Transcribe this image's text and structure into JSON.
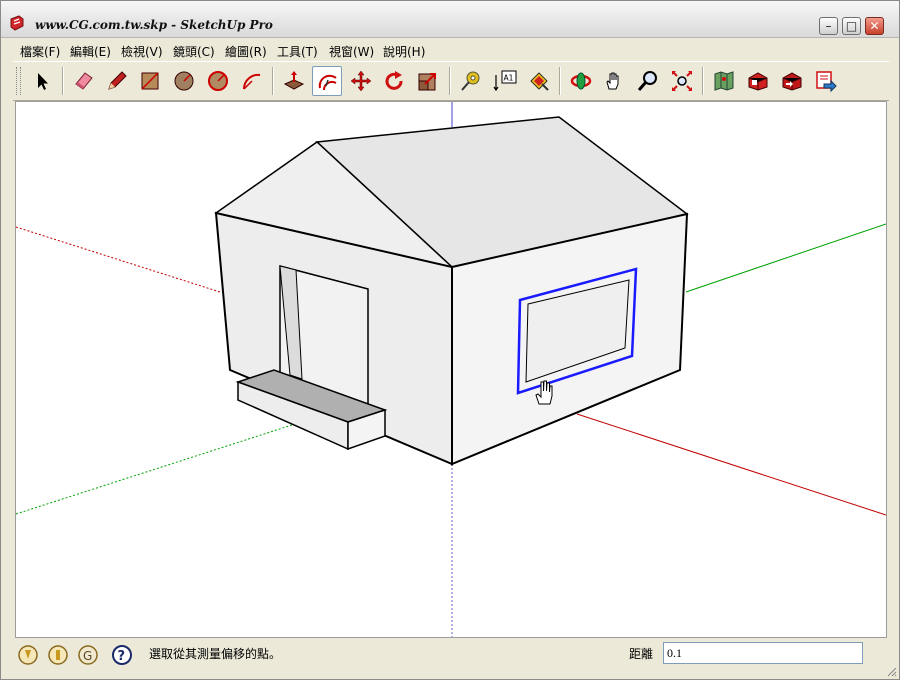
{
  "window": {
    "title": "www.CG.com.tw.skp - SketchUp Pro"
  },
  "menu": [
    {
      "id": "file",
      "label": "檔案(F)"
    },
    {
      "id": "edit",
      "label": "編輯(E)"
    },
    {
      "id": "view",
      "label": "檢視(V)"
    },
    {
      "id": "camera",
      "label": "鏡頭(C)"
    },
    {
      "id": "draw",
      "label": "繪圖(R)"
    },
    {
      "id": "tools",
      "label": "工具(T)"
    },
    {
      "id": "window",
      "label": "視窗(W)"
    },
    {
      "id": "help",
      "label": "說明(H)"
    }
  ],
  "toolbar": {
    "tools": [
      {
        "id": "select",
        "icon": "arrow-cursor-icon"
      },
      {
        "id": "eraser",
        "icon": "eraser-icon"
      },
      {
        "id": "line",
        "icon": "pencil-icon"
      },
      {
        "id": "rectangle",
        "icon": "rectangle-icon"
      },
      {
        "id": "circle",
        "icon": "circle-icon"
      },
      {
        "id": "polygon",
        "icon": "polygon-icon"
      },
      {
        "id": "arc",
        "icon": "arc-icon"
      },
      {
        "id": "push-pull",
        "icon": "push-pull-icon"
      },
      {
        "id": "offset",
        "icon": "offset-icon",
        "active": true
      },
      {
        "id": "move",
        "icon": "move-icon"
      },
      {
        "id": "rotate",
        "icon": "rotate-icon"
      },
      {
        "id": "scale",
        "icon": "scale-icon"
      },
      {
        "id": "tape-measure",
        "icon": "tape-measure-icon"
      },
      {
        "id": "text",
        "icon": "text-label-icon",
        "label": "A1"
      },
      {
        "id": "paint-bucket",
        "icon": "paint-bucket-icon"
      },
      {
        "id": "orbit",
        "icon": "orbit-icon"
      },
      {
        "id": "pan",
        "icon": "pan-hand-icon"
      },
      {
        "id": "zoom",
        "icon": "zoom-icon"
      },
      {
        "id": "zoom-extents",
        "icon": "zoom-extents-icon"
      },
      {
        "id": "map",
        "icon": "map-icon"
      },
      {
        "id": "warehouse-get",
        "icon": "warehouse-get-icon"
      },
      {
        "id": "warehouse-share",
        "icon": "warehouse-share-icon"
      },
      {
        "id": "send-to-layout",
        "icon": "send-to-layout-icon"
      }
    ]
  },
  "statusbar": {
    "icons": [
      "geolocation-icon",
      "credits-icon",
      "google-icon",
      "help-icon"
    ],
    "message": "選取從其測量偏移的點。",
    "vcb_label": "距離",
    "vcb_value": "0.1"
  },
  "colors": {
    "axis_red": "#c00000",
    "axis_green": "#00a000",
    "axis_blue": "#2222cc",
    "selection": "#1a1aff",
    "wall_front": "#efefef",
    "wall_side": "#f4f4f4",
    "roof": "#e8e8e8",
    "step_top": "#b0b0b0"
  }
}
